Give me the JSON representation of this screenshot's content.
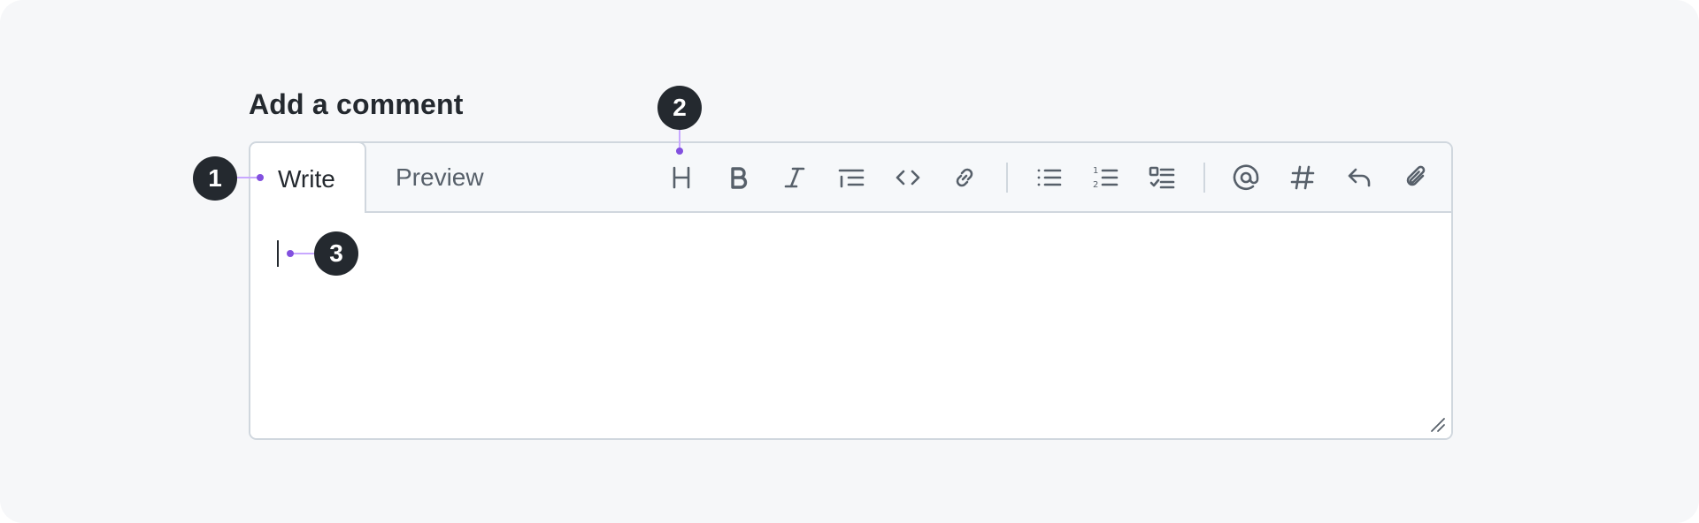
{
  "heading": "Add a comment",
  "tabs": {
    "write": "Write",
    "preview": "Preview"
  },
  "toolbar": {
    "heading_glyph": "H",
    "tools": [
      "heading-icon",
      "bold-icon",
      "italic-icon",
      "quote-icon",
      "code-icon",
      "link-icon",
      "unordered-list-icon",
      "ordered-list-icon",
      "task-list-icon",
      "mention-icon",
      "reference-icon",
      "reply-icon",
      "attach-icon"
    ]
  },
  "editor": {
    "value": ""
  },
  "callouts": [
    "1",
    "2",
    "3"
  ],
  "colors": {
    "callout_bg": "#24292f",
    "callout_dot": "#8250df",
    "border": "#d0d7de",
    "muted": "#57606a"
  }
}
